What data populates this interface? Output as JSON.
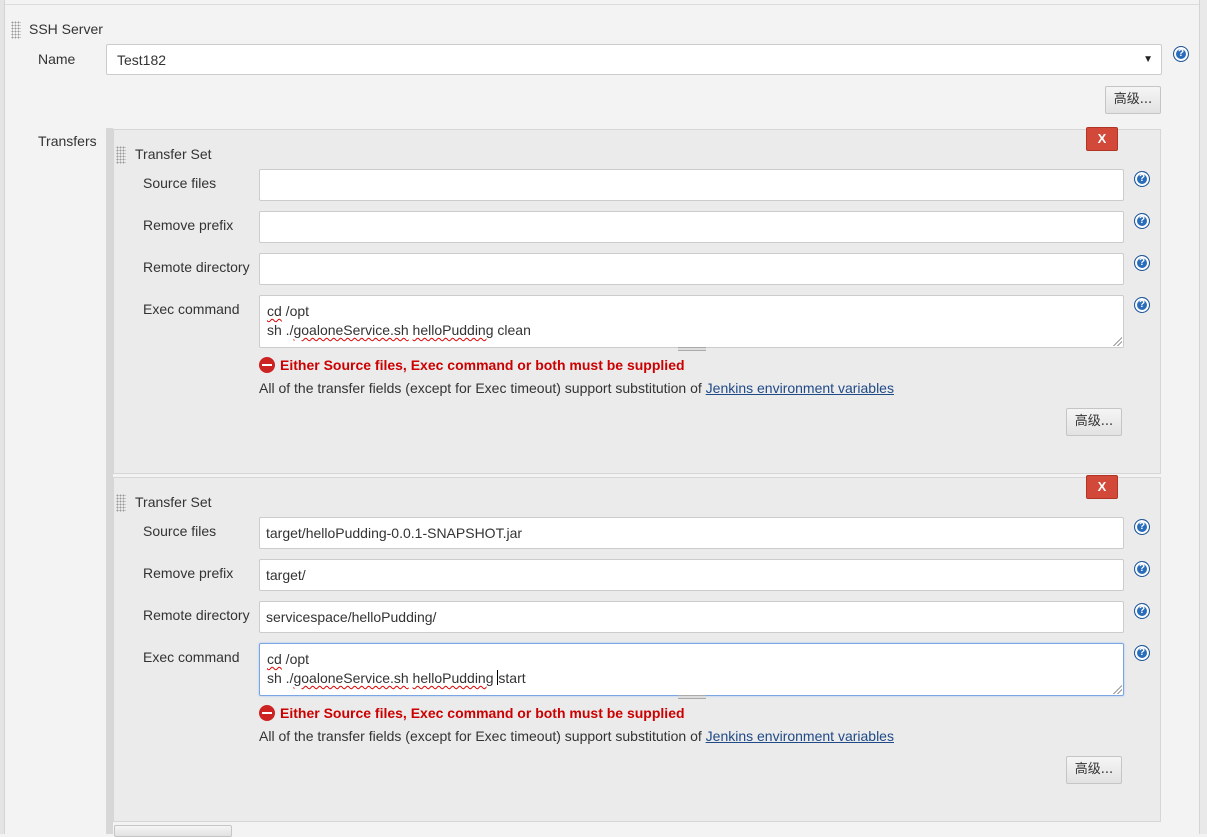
{
  "ssh_server": {
    "title": "SSH Server",
    "name_label": "Name",
    "name_value": "Test182",
    "advanced_label": "高级..."
  },
  "transfers_label": "Transfers",
  "transfer_sets": [
    {
      "title": "Transfer Set",
      "delete_label": "X",
      "source_files_label": "Source files",
      "source_files_value": "",
      "remove_prefix_label": "Remove prefix",
      "remove_prefix_value": "",
      "remote_directory_label": "Remote directory",
      "remote_directory_value": "",
      "exec_command_label": "Exec command",
      "exec_line1_a": "cd",
      "exec_line1_b": " /opt",
      "exec_line2_a": "sh ./",
      "exec_line2_b": "goaloneService.sh",
      "exec_line2_c": " ",
      "exec_line2_d": "helloPudding",
      "exec_line2_e": " clean",
      "error": "Either Source files, Exec command or both must be supplied",
      "info_text": "All of the transfer fields (except for Exec timeout) support substitution of ",
      "info_link": "Jenkins environment variables",
      "advanced_label": "高级..."
    },
    {
      "title": "Transfer Set",
      "delete_label": "X",
      "source_files_label": "Source files",
      "source_files_value": "target/helloPudding-0.0.1-SNAPSHOT.jar",
      "remove_prefix_label": "Remove prefix",
      "remove_prefix_value": "target/",
      "remote_directory_label": "Remote directory",
      "remote_directory_value": "servicespace/helloPudding/",
      "exec_command_label": "Exec command",
      "exec_line1_a": "cd",
      "exec_line1_b": " /opt",
      "exec_line2_a": "sh ./",
      "exec_line2_b": "goaloneService.sh",
      "exec_line2_c": " ",
      "exec_line2_d": "helloPudding",
      "exec_line2_e": "start",
      "error": "Either Source files, Exec command or both must be supplied",
      "info_text": "All of the transfer fields (except for Exec timeout) support substitution of ",
      "info_link": "Jenkins environment variables",
      "advanced_label": "高级..."
    }
  ],
  "colors": {
    "error": "#cc0000",
    "delete_button": "#d24939",
    "help_icon": "#2a6ebb",
    "link": "#204a87"
  }
}
